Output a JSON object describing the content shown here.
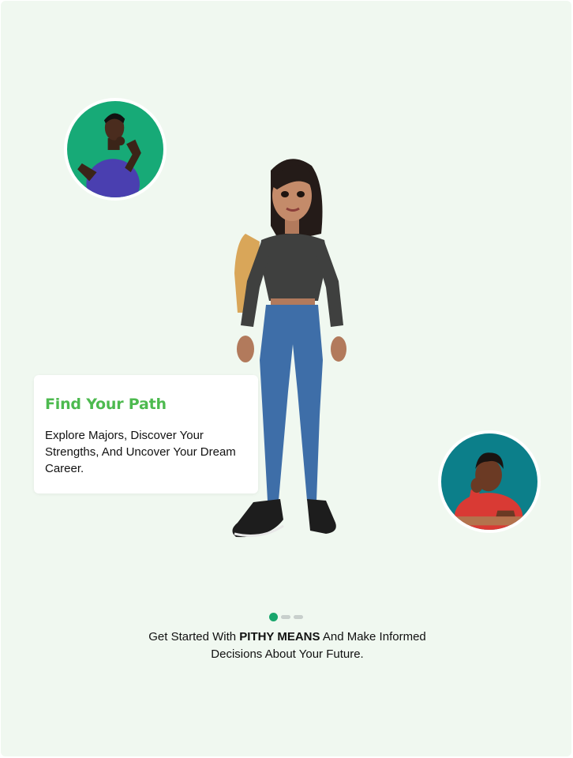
{
  "card": {
    "title": "Find Your Path",
    "description": "Explore Majors, Discover Your Strengths, And Uncover Your Dream Career."
  },
  "pagination": {
    "total": 3,
    "active": 1
  },
  "tagline": {
    "prefix": "Get Started With ",
    "brand": "PITHY MEANS",
    "suffix_line1": " And Make Informed",
    "line2": "Decisions About Your Future."
  },
  "colors": {
    "background": "#f0f8f0",
    "accent_green": "#4dba4f",
    "dot_active": "#18a66c",
    "avatar_left_bg": "#17aa77",
    "avatar_right_bg": "#0c7f8a"
  },
  "illustrations": {
    "avatar_left": "thinking-man-avatar",
    "hero": "student-girl-with-backpack",
    "avatar_right": "bored-boy-avatar"
  }
}
